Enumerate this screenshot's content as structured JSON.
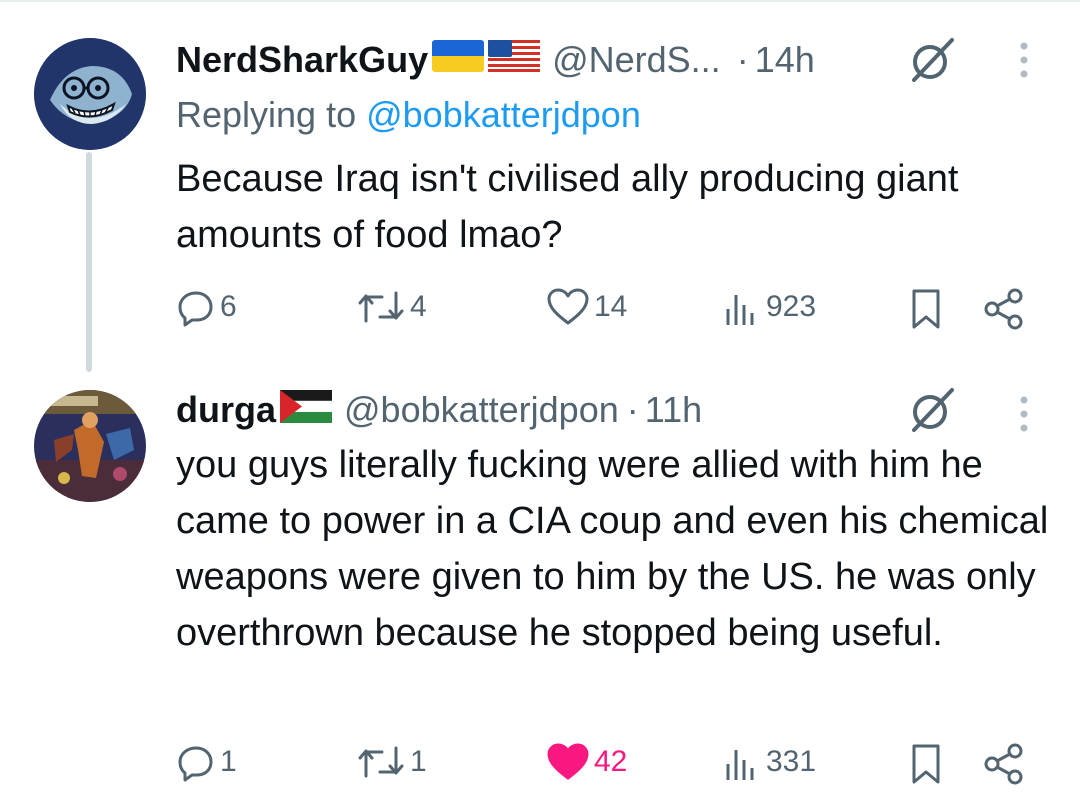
{
  "tweets": [
    {
      "author": "NerdSharkGuy",
      "flags": [
        "ukraine-flag",
        "usa-flag"
      ],
      "handle": "@NerdS...",
      "dot": "·",
      "time": "14h",
      "replying_prefix": "Replying to ",
      "replying_to": "@bobkatterjdpon",
      "text": "Because Iraq isn't civilised ally producing giant amounts of food lmao?",
      "replies": "6",
      "retweets": "4",
      "likes": "14",
      "views": "923",
      "liked": false
    },
    {
      "author": "durga",
      "flags": [
        "palestine-flag"
      ],
      "handle": "@bobkatterjdpon",
      "dot": "·",
      "time": "11h",
      "text": "you guys literally fucking were allied with him he came to power in a CIA coup and even his chemical weapons were given to him by the US. he was only overthrown because he stopped being useful.",
      "replies": "1",
      "retweets": "1",
      "likes": "42",
      "views": "331",
      "liked": true
    }
  ],
  "colors": {
    "text": "#0f1419",
    "secondary": "#536471",
    "link": "#1d9bf0",
    "like": "#f91880",
    "thread_line": "#cfd9de"
  },
  "icons": [
    "grok-icon",
    "more-icon",
    "reply-icon",
    "retweet-icon",
    "like-icon",
    "views-icon",
    "bookmark-icon",
    "share-icon"
  ]
}
